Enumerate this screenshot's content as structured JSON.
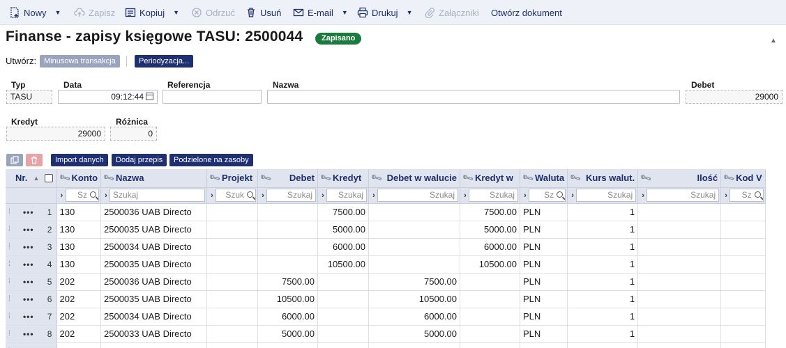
{
  "toolbar": {
    "new": "Nowy",
    "save": "Zapisz",
    "copy": "Kopiuj",
    "discard": "Odrzuć",
    "delete": "Usuń",
    "email": "E-mail",
    "print": "Drukuj",
    "attachments": "Załączniki",
    "open_document": "Otwórz dokument"
  },
  "page": {
    "title": "Finanse - zapisy księgowe TASU: 2500044",
    "status": "Zapisano"
  },
  "create": {
    "label": "Utwórz:",
    "negative_transaction": "Minusowa transakcja",
    "periodization": "Periodyzacja..."
  },
  "fields": {
    "type": {
      "label": "Typ",
      "value": "TASU"
    },
    "date": {
      "label": "Data",
      "value": "09:12:44"
    },
    "reference": {
      "label": "Referencja",
      "value": ""
    },
    "name": {
      "label": "Nazwa",
      "value": ""
    },
    "debit": {
      "label": "Debet",
      "value": "29000"
    },
    "credit": {
      "label": "Kredyt",
      "value": "29000"
    },
    "difference": {
      "label": "Różnica",
      "value": "0"
    }
  },
  "grid_buttons": {
    "import": "Import danych",
    "add_template": "Dodaj przepis",
    "split": "Podzielone na zasoby"
  },
  "table": {
    "columns": {
      "nr": "Nr.",
      "account": "Konto",
      "name": "Nazwa",
      "project": "Projekt",
      "debit": "Debet",
      "credit": "Kredyt",
      "debit_cur": "Debet w walucie",
      "credit_cur": "Kredyt w",
      "currency": "Waluta",
      "rate": "Kurs walut.",
      "qty": "Ilość",
      "code": "Kod V"
    },
    "filter": {
      "account": "Sz",
      "name": "Szukaj",
      "project": "Szuk",
      "debit": "Szukaj",
      "credit": "Szukaj",
      "debit_cur": "Szukaj",
      "credit_cur": "Szukaj",
      "currency": "Sz",
      "rate": "Szukaj",
      "qty": "Szukaj",
      "code": "Sz"
    },
    "rows": [
      {
        "nr": "1",
        "account": "130",
        "name": "2500036 UAB Directo",
        "project": "",
        "debit": "",
        "credit": "7500.00",
        "debit_cur": "",
        "credit_cur": "7500.00",
        "currency": "PLN",
        "rate": "1",
        "qty": "",
        "code": ""
      },
      {
        "nr": "2",
        "account": "130",
        "name": "2500035 UAB Directo",
        "project": "",
        "debit": "",
        "credit": "5000.00",
        "debit_cur": "",
        "credit_cur": "5000.00",
        "currency": "PLN",
        "rate": "1",
        "qty": "",
        "code": ""
      },
      {
        "nr": "3",
        "account": "130",
        "name": "2500034 UAB Directo",
        "project": "",
        "debit": "",
        "credit": "6000.00",
        "debit_cur": "",
        "credit_cur": "6000.00",
        "currency": "PLN",
        "rate": "1",
        "qty": "",
        "code": ""
      },
      {
        "nr": "4",
        "account": "130",
        "name": "2500035 UAB Directo",
        "project": "",
        "debit": "",
        "credit": "10500.00",
        "debit_cur": "",
        "credit_cur": "10500.00",
        "currency": "PLN",
        "rate": "1",
        "qty": "",
        "code": ""
      },
      {
        "nr": "5",
        "account": "202",
        "name": "2500036 UAB Directo",
        "project": "",
        "debit": "7500.00",
        "credit": "",
        "debit_cur": "7500.00",
        "credit_cur": "",
        "currency": "PLN",
        "rate": "1",
        "qty": "",
        "code": ""
      },
      {
        "nr": "6",
        "account": "202",
        "name": "2500035 UAB Directo",
        "project": "",
        "debit": "10500.00",
        "credit": "",
        "debit_cur": "10500.00",
        "credit_cur": "",
        "currency": "PLN",
        "rate": "1",
        "qty": "",
        "code": ""
      },
      {
        "nr": "7",
        "account": "202",
        "name": "2500034 UAB Directo",
        "project": "",
        "debit": "6000.00",
        "credit": "",
        "debit_cur": "6000.00",
        "credit_cur": "",
        "currency": "PLN",
        "rate": "1",
        "qty": "",
        "code": ""
      },
      {
        "nr": "8",
        "account": "202",
        "name": "2500033 UAB Directo",
        "project": "",
        "debit": "5000.00",
        "credit": "",
        "debit_cur": "5000.00",
        "credit_cur": "",
        "currency": "PLN",
        "rate": "1",
        "qty": "",
        "code": ""
      },
      {
        "nr": "9",
        "account": "",
        "name": "",
        "project": "",
        "debit": "",
        "credit": "",
        "debit_cur": "",
        "credit_cur": "",
        "currency": "",
        "rate": "",
        "qty": "",
        "code": ""
      }
    ]
  },
  "colors": {
    "accent_navy": "#1f2f73",
    "status_green": "#1b7a3d",
    "header_bg": "#dfe4ee"
  },
  "icons": [
    "new-doc-icon",
    "cloud-upload-icon",
    "copy-icon",
    "cancel-circle-icon",
    "trash-icon",
    "mail-icon",
    "printer-icon",
    "paperclip-icon",
    "calendar-icon",
    "wrench-icon",
    "search-icon"
  ]
}
